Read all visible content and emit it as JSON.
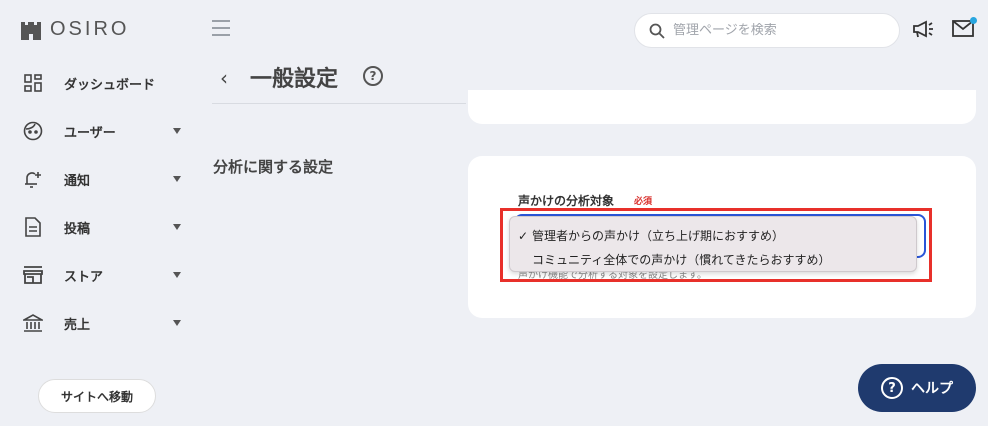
{
  "app": {
    "logo_text": "OSIRO"
  },
  "sidebar": {
    "items": [
      {
        "label": "ダッシュボード",
        "icon": "dashboard-icon",
        "has_caret": false
      },
      {
        "label": "ユーザー",
        "icon": "user-face-icon",
        "has_caret": true
      },
      {
        "label": "通知",
        "icon": "bell-plus-icon",
        "has_caret": true
      },
      {
        "label": "投稿",
        "icon": "document-icon",
        "has_caret": true
      },
      {
        "label": "ストア",
        "icon": "store-icon",
        "has_caret": true
      },
      {
        "label": "売上",
        "icon": "bank-icon",
        "has_caret": true
      }
    ],
    "site_button": "サイトへ移動"
  },
  "topbar": {
    "search_placeholder": "管理ページを検索",
    "icons": [
      "hamburger-icon",
      "search-icon",
      "megaphone-icon",
      "mail-icon"
    ],
    "notification_dot_color": "#28a6e0"
  },
  "page": {
    "title": "一般設定",
    "section_label": "分析に関する設定"
  },
  "field": {
    "label": "声かけの分析対象",
    "required": "必須",
    "help_text": "声かけ機能で分析する対象を設定します。"
  },
  "dropdown": {
    "options": [
      {
        "label": "管理者からの声かけ（立ち上げ期におすすめ）",
        "selected": true
      },
      {
        "label": "コミュニティ全体での声かけ（慣れてきたらおすすめ）",
        "selected": false
      }
    ],
    "check_mark": "✓"
  },
  "help_button": {
    "label": "ヘルプ",
    "icon_text": "?"
  },
  "colors": {
    "accent": "#1f3a6e",
    "required": "#d9302c",
    "highlight": "#e8302a",
    "select_border": "#2a55d8"
  }
}
